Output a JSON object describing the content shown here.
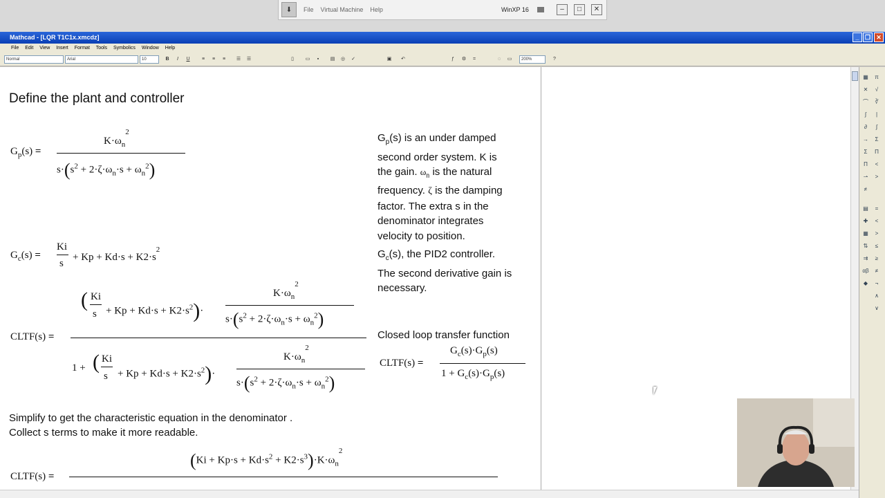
{
  "vm": {
    "menu": [
      "File",
      "Virtual Machine",
      "Help"
    ],
    "name": "WinXP 16"
  },
  "window": {
    "title": "Mathcad - [LQR T1C1x.xmcdz]"
  },
  "menubar": [
    "File",
    "Edit",
    "View",
    "Insert",
    "Format",
    "Tools",
    "Symbolics",
    "Window",
    "Help"
  ],
  "toolbar": {
    "style": "Normal",
    "font": "Arial",
    "size": "10",
    "zoom": "200%"
  },
  "doc": {
    "heading": "Define the plant and controller",
    "gp_desc_lines": [
      "is an under damped",
      "second order system. K is",
      "the gain.",
      "is the natural",
      "frequency.",
      "is the damping",
      "factor.  The extra s in the",
      "denominator integrates",
      "velocity to position."
    ],
    "gc_desc": ", the PID2 controller.",
    "gc_desc2": "The second derivative gain is",
    "gc_desc3": "necessary.",
    "cltf_desc": "Closed loop transfer function",
    "simplify1": "Simplify to get the characteristic equation in the denominator .",
    "simplify2": "Collect s terms to make it more readable."
  },
  "colors": {
    "titlebar": "#0a3fb5",
    "doc_bg": "#ffffff",
    "chrome": "#ece9d8"
  }
}
